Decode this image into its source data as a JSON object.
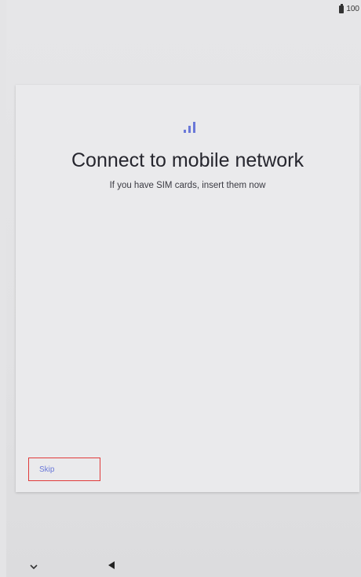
{
  "status_bar": {
    "battery_text": "100",
    "battery_icon": "battery-icon"
  },
  "setup": {
    "icon": "signal-icon",
    "title": "Connect to mobile network",
    "subtitle": "If you have SIM cards, insert them now",
    "skip_label": "Skip"
  },
  "nav": {
    "down_icon": "chevron-down-icon",
    "back_icon": "back-triangle-icon"
  },
  "colors": {
    "accent": "#6a78d8",
    "highlight_border": "#e03a3a",
    "title": "#26262e"
  }
}
